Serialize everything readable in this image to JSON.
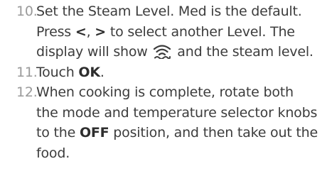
{
  "steps": [
    {
      "number": "10.",
      "text_a": "Set the Steam Level. Med is the default. Press ",
      "key_prev": "<",
      "sep": ", ",
      "key_next": ">",
      "text_b": " to select another Level. The display will show ",
      "icon": "steam-icon",
      "text_c": " and the steam level."
    },
    {
      "number": "11.",
      "text_a": "Touch ",
      "key": "OK",
      "text_b": "."
    },
    {
      "number": "12.",
      "text_a": "When cooking is complete, rotate both the mode and temperature selector knobs to the ",
      "key": "OFF",
      "text_b": " position, and then take out the food."
    }
  ],
  "colors": {
    "text": "#3c3c3c",
    "number": "#9a9a9a"
  }
}
